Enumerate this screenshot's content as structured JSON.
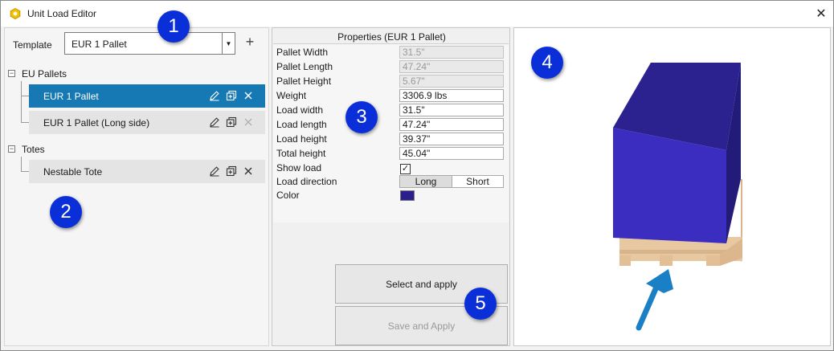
{
  "window": {
    "title": "Unit Load Editor",
    "close_glyph": "✕"
  },
  "template": {
    "label": "Template",
    "value": "EUR 1 Pallet",
    "add_glyph": "+"
  },
  "groups": [
    {
      "toggle": "−",
      "label": "EU Pallets",
      "items": [
        {
          "label": "EUR 1 Pallet",
          "selected": true
        },
        {
          "label": "EUR 1 Pallet (Long side)",
          "selected": false
        }
      ]
    },
    {
      "toggle": "−",
      "label": "Totes",
      "items": [
        {
          "label": "Nestable Tote",
          "selected": false
        }
      ]
    }
  ],
  "properties": {
    "title": "Properties (EUR 1 Pallet)",
    "rows": [
      {
        "label": "Pallet Width",
        "value": "31.5\"",
        "disabled": true
      },
      {
        "label": "Pallet Length",
        "value": "47.24\"",
        "disabled": true
      },
      {
        "label": "Pallet Height",
        "value": "5.67\"",
        "disabled": true
      },
      {
        "label": "Weight",
        "value": "3306.9 lbs",
        "disabled": false
      },
      {
        "label": "Load width",
        "value": "31.5\"",
        "disabled": false
      },
      {
        "label": "Load length",
        "value": "47.24\"",
        "disabled": false
      },
      {
        "label": "Load height",
        "value": "39.37\"",
        "disabled": false
      },
      {
        "label": "Total height",
        "value": "45.04\"",
        "disabled": false
      }
    ],
    "show_load": {
      "label": "Show load",
      "checked": true,
      "check_glyph": "✓"
    },
    "load_direction": {
      "label": "Load direction",
      "options": [
        "Long",
        "Short"
      ],
      "selected": "Long"
    },
    "color": {
      "label": "Color",
      "value": "#2a1f8c"
    }
  },
  "buttons": {
    "select_apply": "Select and apply",
    "save_apply": "Save and Apply"
  },
  "callouts": [
    "1",
    "2",
    "3",
    "4",
    "5"
  ],
  "colors": {
    "selection": "#1679b4",
    "load_front": "#3a2dbf",
    "load_top": "#2b2290",
    "load_side": "#241c7c",
    "pallet_wood": "#e8c8a0",
    "arrow": "#1a7fc4"
  }
}
